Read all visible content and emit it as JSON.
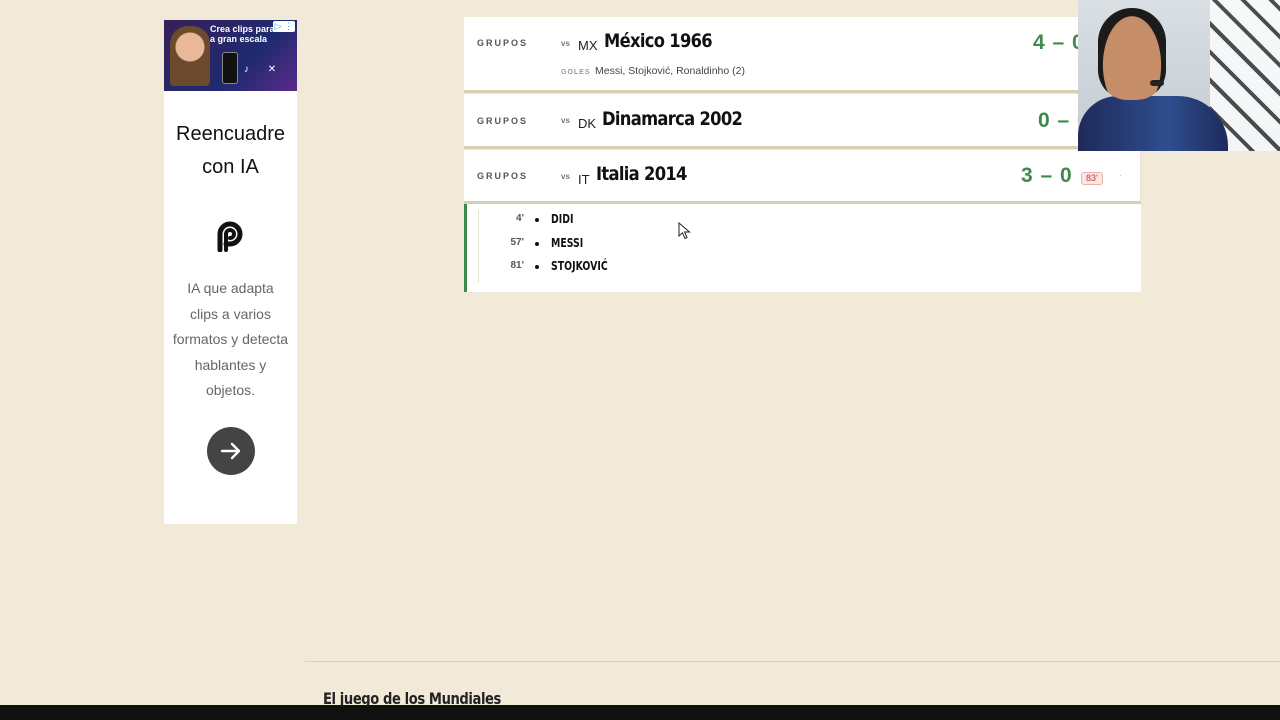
{
  "ad": {
    "banner_text": "Crea clips para a gran escala",
    "adchoice": "▷ ⋮",
    "title": "Reencuadre con IA",
    "logo_icon": "opus-clip-logo",
    "description": "IA que adapta clips a varios formatos y detecta hablantes y objetos.",
    "cta_icon": "arrow-right-icon"
  },
  "matches": [
    {
      "stage": "GRUPOS",
      "vs": "vs",
      "code": "MX",
      "name": "México 1966",
      "score": "4 – 0",
      "goals_label": "GOLES",
      "goals": "Messi, Stojković, Ronaldinho (2)"
    },
    {
      "stage": "GRUPOS",
      "vs": "vs",
      "code": "DK",
      "name": "Dinamarca 2002",
      "score": "0 – 0"
    },
    {
      "stage": "GRUPOS",
      "vs": "vs",
      "code": "IT",
      "name": "Italia 2014",
      "score": "3 – 0",
      "minute_badge": "83'",
      "extra_mark": "·"
    }
  ],
  "scorers": [
    {
      "minute": "4'",
      "name": "DIDI"
    },
    {
      "minute": "57'",
      "name": "MESSI"
    },
    {
      "minute": "81'",
      "name": "STOJKOVIĆ"
    }
  ],
  "footer": {
    "title": "El juego de los Mundiales"
  },
  "colors": {
    "background": "#f1ead9",
    "score_green": "#3d8a4c",
    "row_border": "#d5cfb3",
    "badge_red": "#c23a3a"
  }
}
